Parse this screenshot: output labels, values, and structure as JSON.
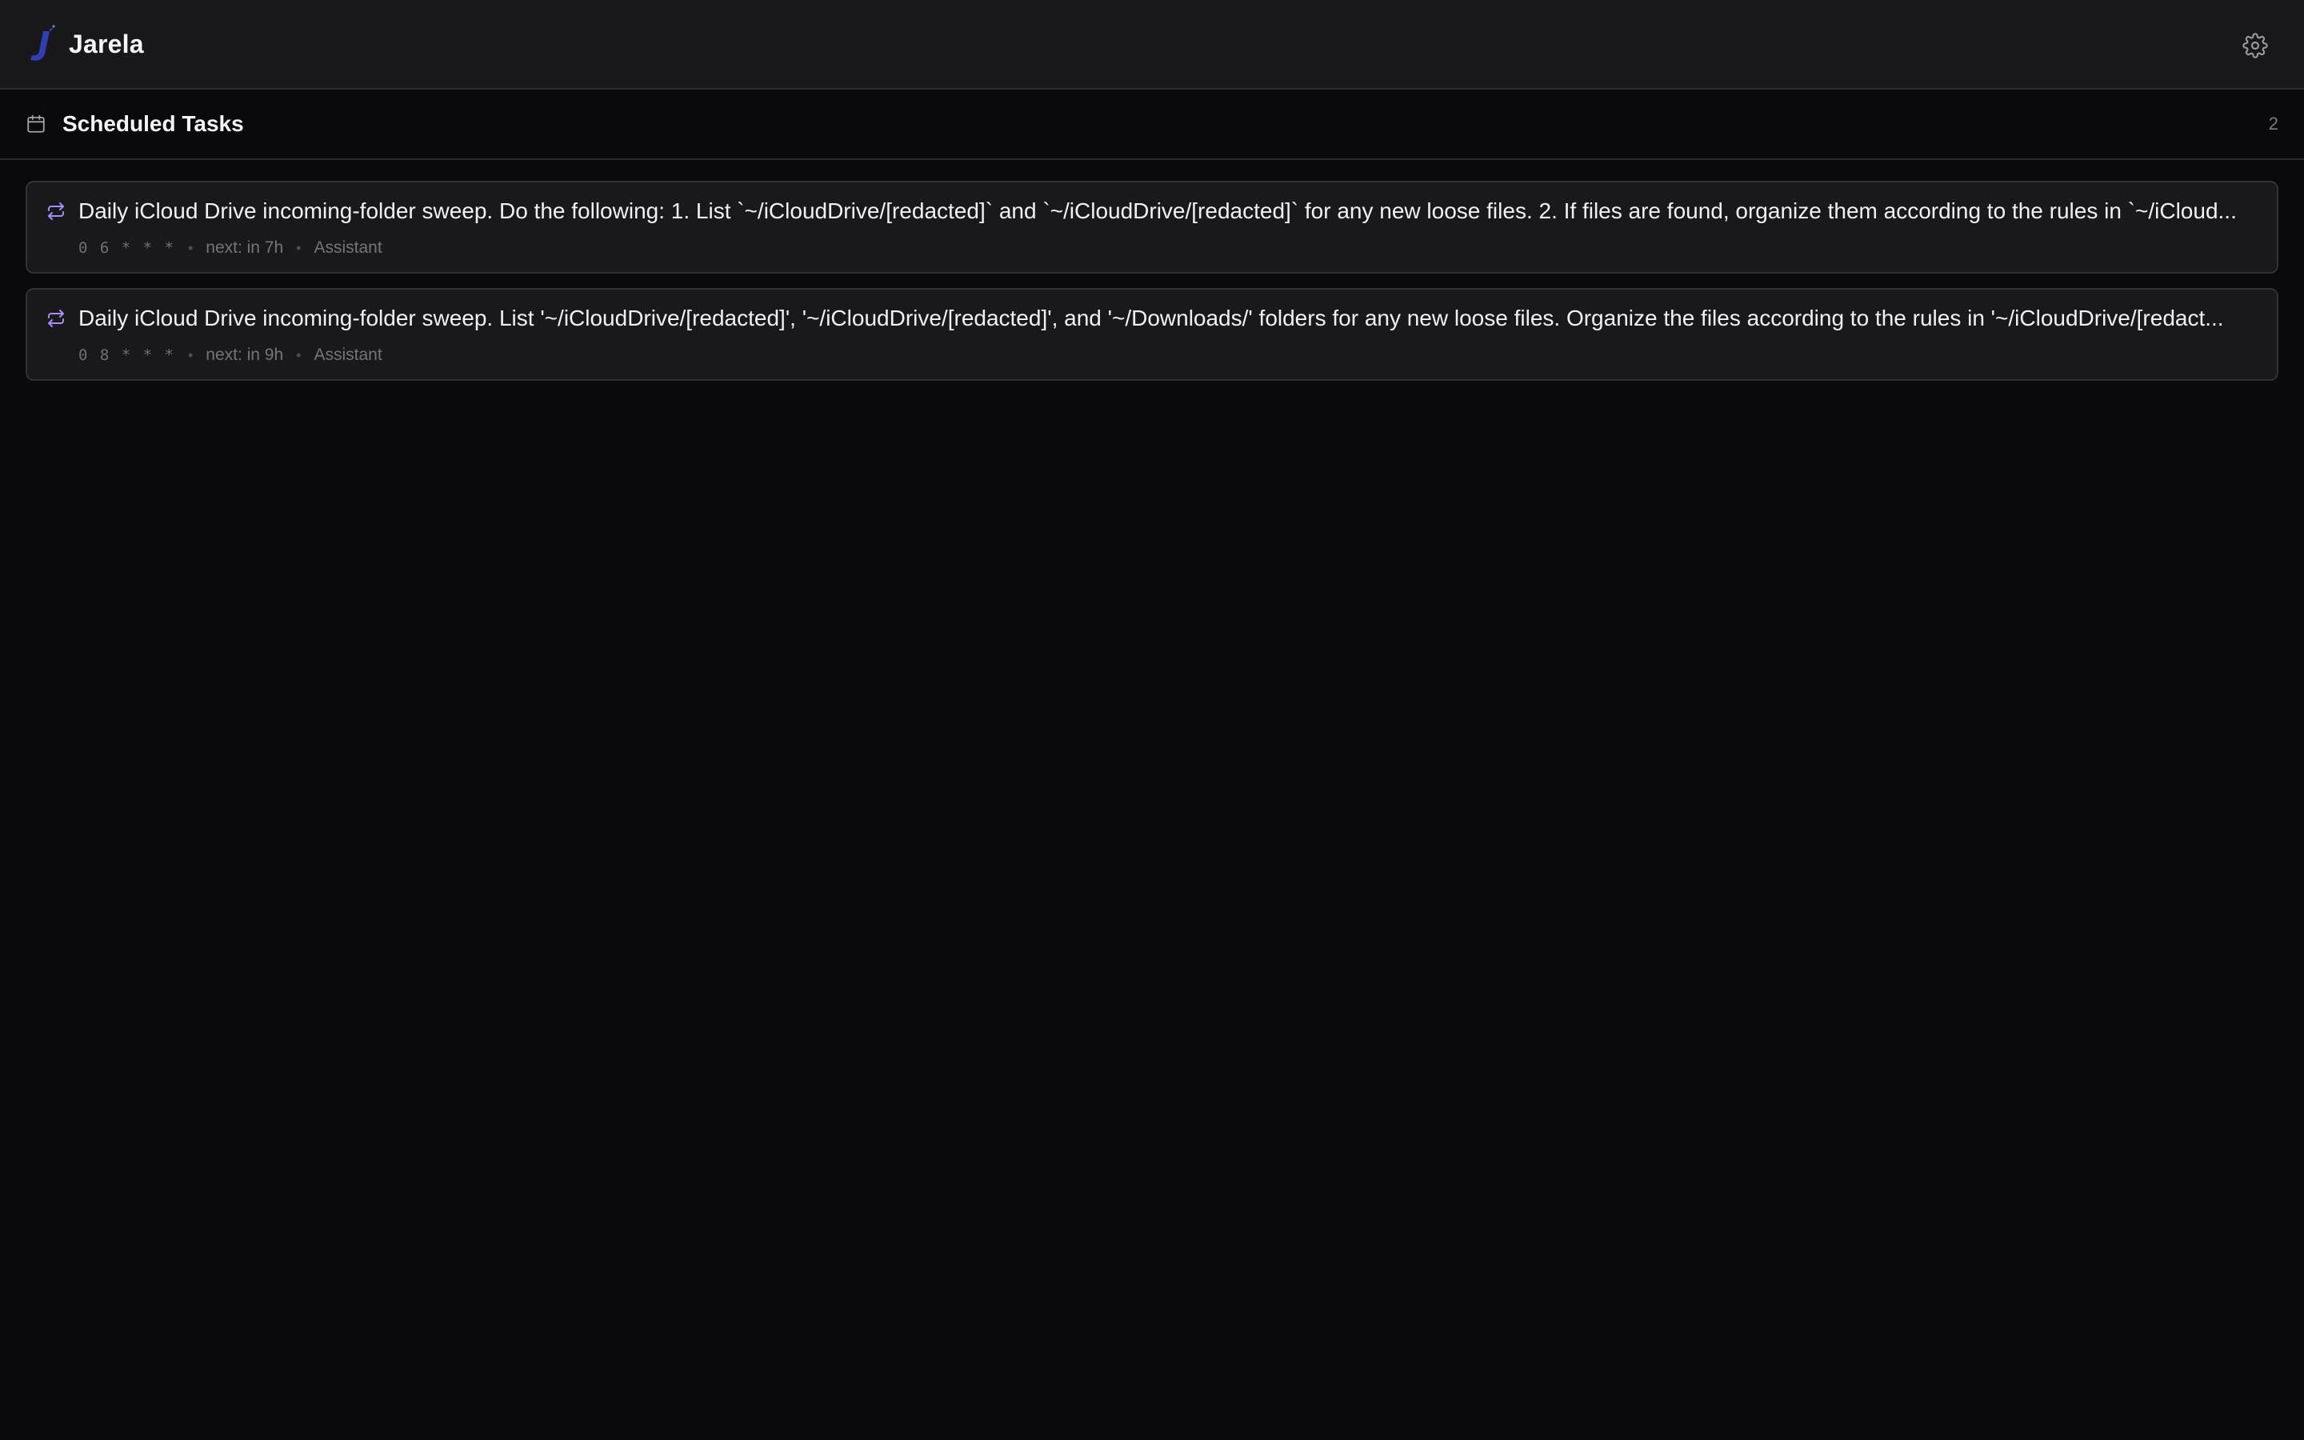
{
  "app": {
    "name": "Jarela",
    "logo_icon": "jarela-logo-icon",
    "settings_icon": "gear-icon"
  },
  "section": {
    "title": "Scheduled Tasks",
    "count": "2",
    "icon": "calendar-icon"
  },
  "tasks": [
    {
      "title": "Daily iCloud Drive incoming-folder sweep. Do the following: 1. List `~/iCloudDrive/[redacted]` and `~/iCloudDrive/[redacted]` for any new loose files. 2. If files are found, organize them according to the rules in `~/iCloud...",
      "cron": "0 6 * * *",
      "next": "next: in 7h",
      "agent": "Assistant",
      "icon": "repeat-icon"
    },
    {
      "title": "Daily iCloud Drive incoming-folder sweep. List '~/iCloudDrive/[redacted]', '~/iCloudDrive/[redacted]', and '~/Downloads/' folders for any new loose files. Organize the files according to the rules in '~/iCloudDrive/[redact...",
      "cron": "0 8 * * *",
      "next": "next: in 9h",
      "agent": "Assistant",
      "icon": "repeat-icon"
    }
  ],
  "colors": {
    "background": "#0a0a0c",
    "topbar": "#18181b",
    "card": "#19191c",
    "accent_repeat": "#a78bfa",
    "logo": "#2f3fb0"
  }
}
